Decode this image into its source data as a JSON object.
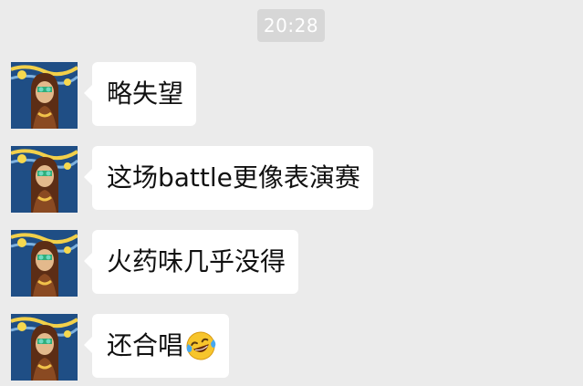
{
  "chat": {
    "timestamp": "20:28",
    "messages": [
      {
        "text": "略失望"
      },
      {
        "text": "这场battle更像表演赛"
      },
      {
        "text": "火药味几乎没得"
      },
      {
        "text": "还合唱",
        "emoji": "laughing-tears-emoji"
      }
    ]
  },
  "colors": {
    "background": "#ebebeb",
    "bubble": "#ffffff",
    "timestamp_bg": "#d7d7d7",
    "timestamp_text": "#ffffff",
    "text": "#111111"
  }
}
